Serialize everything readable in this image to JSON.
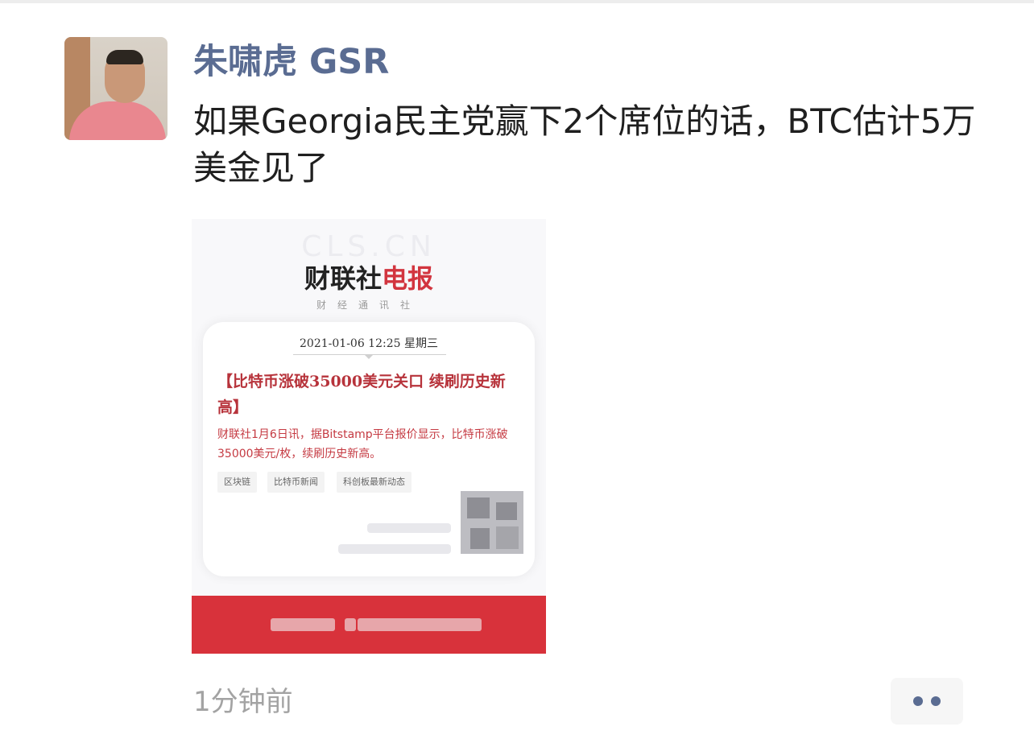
{
  "post": {
    "author": "朱啸虎 GSR",
    "text": "如果Georgia民主党赢下2个席位的话，BTC估计5万美金见了",
    "timestamp": "1分钟前"
  },
  "shared_image": {
    "watermark": "CLS.CN",
    "brand_part1": "财联社",
    "brand_part2": "电报",
    "brand_sub": "财经通讯社",
    "datetime": "2021-01-06 12:25 星期三",
    "headline": "【比特币涨破35000美元关口  续刷历史新高】",
    "body": "财联社1月6日讯，据Bitstamp平台报价显示，比特币涨破35000美元/枚，续刷历史新高。",
    "tags": [
      "区块链",
      "比特币新闻",
      "科创板最新动态"
    ]
  },
  "colors": {
    "author_name": "#5a6c92",
    "headline_red": "#b7333b",
    "banner_red": "#d8323b",
    "timestamp_gray": "#a3a3a3"
  },
  "icons": {
    "more": "ellipsis-icon"
  }
}
